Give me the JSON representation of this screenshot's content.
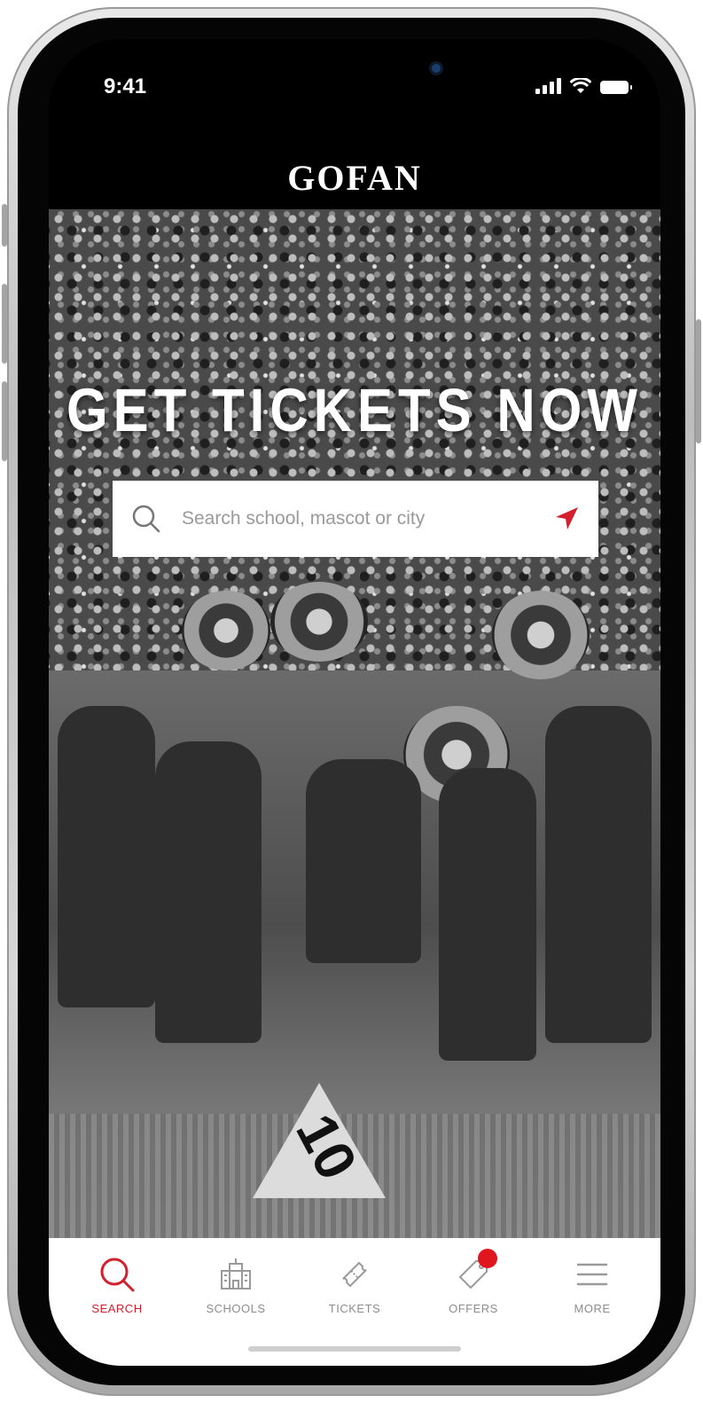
{
  "status_bar": {
    "time": "9:41"
  },
  "header": {
    "logo_text": "GOFAN"
  },
  "hero": {
    "title": "GET TICKETS NOW",
    "marker_text": "10"
  },
  "search": {
    "placeholder": "Search school, mascot or city",
    "value": ""
  },
  "bottom_nav": {
    "items": [
      {
        "label": "SEARCH",
        "icon": "search-icon",
        "active": true
      },
      {
        "label": "SCHOOLS",
        "icon": "school-building-icon",
        "active": false
      },
      {
        "label": "TICKETS",
        "icon": "ticket-icon",
        "active": false
      },
      {
        "label": "OFFERS",
        "icon": "offer-tag-icon",
        "active": false,
        "badge": ""
      },
      {
        "label": "MORE",
        "icon": "hamburger-menu-icon",
        "active": false
      }
    ]
  },
  "colors": {
    "accent": "#d4202e",
    "badge": "#e0161f",
    "inactive": "#8d8d8d"
  }
}
